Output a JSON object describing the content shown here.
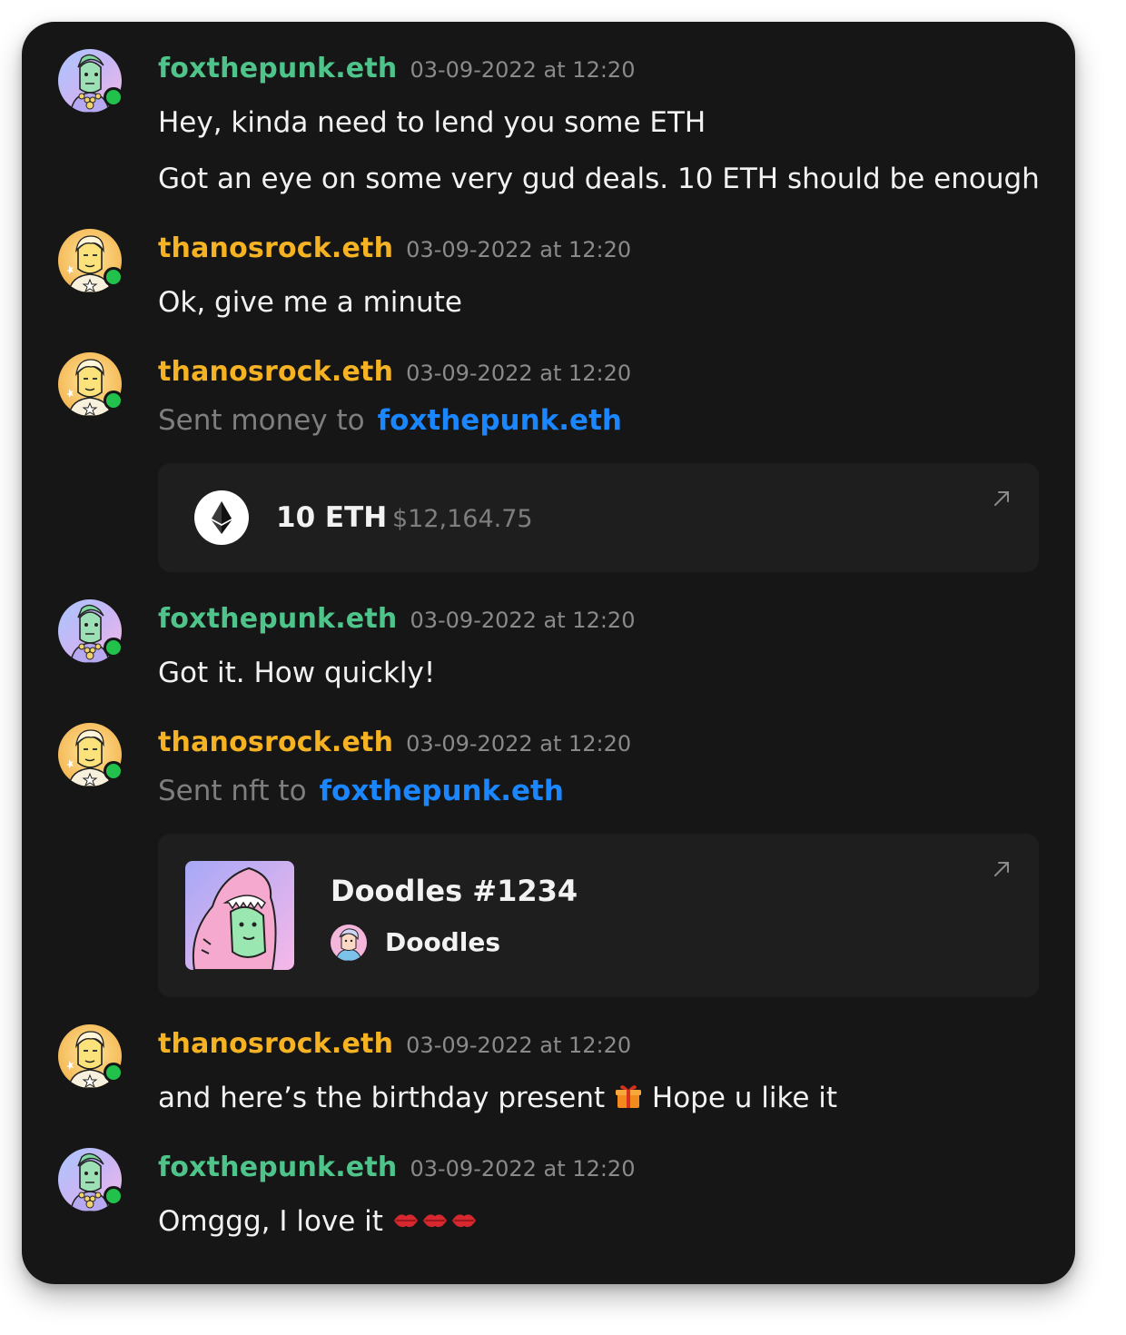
{
  "users": {
    "fox": {
      "name": "foxthepunk.eth",
      "color": "#4fc48a"
    },
    "thanos": {
      "name": "thanosrock.eth",
      "color": "#f5b323"
    }
  },
  "messages": [
    {
      "user": "foxthepunk.eth",
      "time": "03-09-2022 at 12:20",
      "lines": [
        "Hey, kinda need to lend you some ETH",
        "Got an eye on some very gud deals. 10 ETH should be enough"
      ]
    },
    {
      "user": "thanosrock.eth",
      "time": "03-09-2022 at 12:20",
      "lines": [
        "Ok, give me a minute"
      ]
    },
    {
      "user": "thanosrock.eth",
      "time": "03-09-2022 at 12:20",
      "action": "Sent money to",
      "target": "foxthepunk.eth",
      "transfer": {
        "icon": "ethereum-icon",
        "amount": "10 ETH",
        "usd": "$12,164.75"
      }
    },
    {
      "user": "foxthepunk.eth",
      "time": "03-09-2022 at 12:20",
      "lines": [
        "Got it. How quickly!"
      ]
    },
    {
      "user": "thanosrock.eth",
      "time": "03-09-2022 at 12:20",
      "action": "Sent nft to",
      "target": "foxthepunk.eth",
      "nft": {
        "title": "Doodles #1234",
        "collection": "Doodles"
      }
    },
    {
      "user": "thanosrock.eth",
      "time": "03-09-2022 at 12:20",
      "text_before": "and here’s the birthday present",
      "emoji": "gift-icon",
      "text_after": "Hope u like it"
    },
    {
      "user": "foxthepunk.eth",
      "time": "03-09-2022 at 12:20",
      "text_before": "Omggg, I love it",
      "emoji": "kiss-mark-icon"
    }
  ],
  "colors": {
    "background": "#161616",
    "card": "#1e1e1e",
    "link": "#1a86ff",
    "online": "#21c14b",
    "muted": "#8a8a8a"
  }
}
